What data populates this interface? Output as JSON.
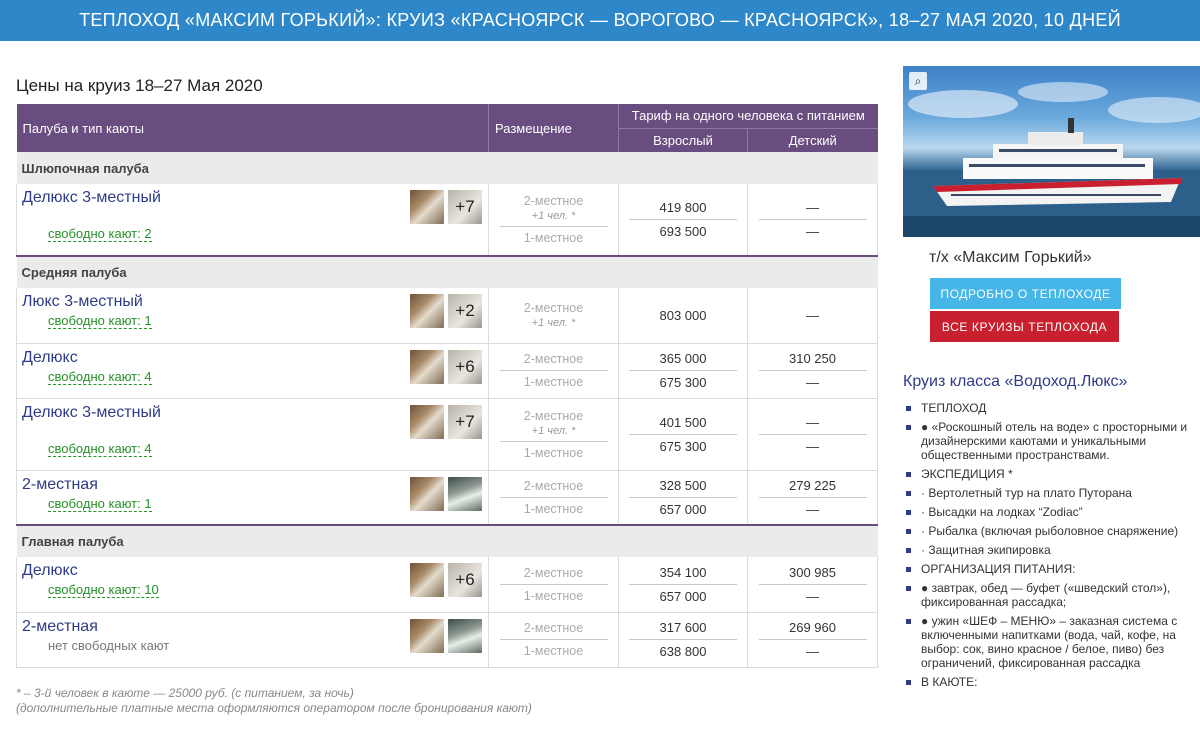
{
  "banner": "ТЕПЛОХОД «МАКСИМ ГОРЬКИЙ»: КРУИЗ «КРАСНОЯРСК — ВОРОГОВО — КРАСНОЯРСК», 18–27 МАЯ 2020, 10  ДНЕЙ",
  "prices_title": "Цены на круиз 18–27 Мая 2020",
  "table_header": {
    "deck": "Палуба и тип каюты",
    "placement": "Размещение",
    "tariff": "Тариф на одного человека с питанием",
    "adult": "Взрослый",
    "child": "Детский"
  },
  "decks": [
    {
      "name": "Шлюпочная палуба",
      "cabins": [
        {
          "name": "Делюкс 3-местный",
          "avail": "свободно кают: 2",
          "more": "+7",
          "thumb2": false,
          "places": [
            {
              "label": "2-местное",
              "extra": "+1 чел. *"
            },
            {
              "label": "1-местное"
            }
          ],
          "adult": [
            "419 800",
            "693 500"
          ],
          "child": [
            "—",
            "—"
          ],
          "h": 72
        }
      ]
    },
    {
      "name": "Средняя палуба",
      "cabins": [
        {
          "name": "Люкс 3-местный",
          "avail": "свободно кают: 1",
          "more": "+2",
          "thumb2": false,
          "places": [
            {
              "label": "2-местное",
              "extra": "+1 чел. *"
            }
          ],
          "adult": [
            "803 000"
          ],
          "child": [
            "—"
          ],
          "h": 55
        },
        {
          "name": "Делюкс",
          "avail": "свободно кают: 4",
          "more": "+6",
          "thumb2": false,
          "places": [
            {
              "label": "2-местное"
            },
            {
              "label": "1-местное"
            }
          ],
          "adult": [
            "365 000",
            "675 300"
          ],
          "child": [
            "310 250",
            "—"
          ],
          "h": 55
        },
        {
          "name": "Делюкс 3-местный",
          "avail": "свободно кают: 4",
          "more": "+7",
          "thumb2": false,
          "places": [
            {
              "label": "2-местное",
              "extra": "+1 чел. *"
            },
            {
              "label": "1-местное"
            }
          ],
          "adult": [
            "401 500",
            "675 300"
          ],
          "child": [
            "—",
            "—"
          ],
          "h": 72
        },
        {
          "name": "2-местная",
          "avail": "свободно кают: 1",
          "more": "",
          "thumb2": true,
          "places": [
            {
              "label": "2-местное"
            },
            {
              "label": "1-местное"
            }
          ],
          "adult": [
            "328 500",
            "657 000"
          ],
          "child": [
            "279 225",
            "—"
          ],
          "h": 55
        }
      ]
    },
    {
      "name": "Главная палуба",
      "cabins": [
        {
          "name": "Делюкс",
          "avail": "свободно кают: 10",
          "more": "+6",
          "thumb2": false,
          "places": [
            {
              "label": "2-местное"
            },
            {
              "label": "1-местное"
            }
          ],
          "adult": [
            "354 100",
            "657 000"
          ],
          "child": [
            "300 985",
            "—"
          ],
          "h": 55
        },
        {
          "name": "2-местная",
          "avail": "нет свободных кают",
          "avail_none": true,
          "more": "",
          "thumb2": true,
          "places": [
            {
              "label": "2-местное"
            },
            {
              "label": "1-местное"
            }
          ],
          "adult": [
            "317 600",
            "638 800"
          ],
          "child": [
            "269 960",
            "—"
          ],
          "h": 55
        }
      ]
    }
  ],
  "footnote_1": "* – 3-й человек в каюте — 25000 руб. (с питанием, за ночь)",
  "footnote_2": "(дополнительные платные места оформляются оператором после бронирования кают)",
  "sidebar": {
    "ship_name": "т/х «Максим Горький»",
    "btn_details": "ПОДРОБНО О ТЕПЛОХОДЕ",
    "btn_cruises": "ВСЕ КРУИЗЫ ТЕПЛОХОДА",
    "class_title": "Круиз класса «Водоход.Люкс»",
    "features": [
      "ТЕПЛОХОД",
      "● «Роскошный отель на воде» с просторными и дизайнерскими каютами и уникальными общественными пространствами.",
      "ЭКСПЕДИЦИЯ *",
      "· Вертолетный тур на плато Путорана",
      "· Высадки на лодках “Zodiac”",
      "· Рыбалка (включая рыболовное снаряжение)",
      "· Защитная экипировка",
      "ОРГАНИЗАЦИЯ ПИТАНИЯ:",
      "● завтрак, обед — буфет («шведский стол»), фиксированная рассадка;",
      "● ужин «ШЕФ – МЕНЮ» – заказная система с включенными напитками (вода, чай, кофе, на выбор: сок, вино красное / белое, пиво) без ограничений, фиксированная рассадка",
      "В КАЮТЕ:"
    ]
  }
}
